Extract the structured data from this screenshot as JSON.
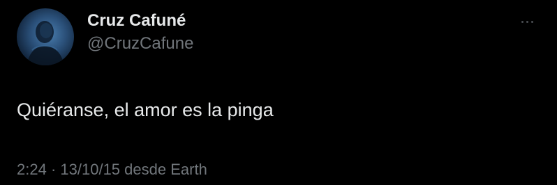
{
  "author": {
    "display_name": "Cruz Cafuné",
    "handle": "@CruzCafune",
    "avatar_icon": "profile-photo"
  },
  "more_icon": "more-horizontal-icon",
  "tweet": {
    "text": "Quiéranse, el amor es la pinga"
  },
  "meta": {
    "time": "2:24",
    "separator": "·",
    "date": "13/10/15",
    "source": "desde Earth"
  },
  "colors": {
    "background": "#000000",
    "primary_text": "#e7e9ea",
    "secondary_text": "#71767b"
  }
}
